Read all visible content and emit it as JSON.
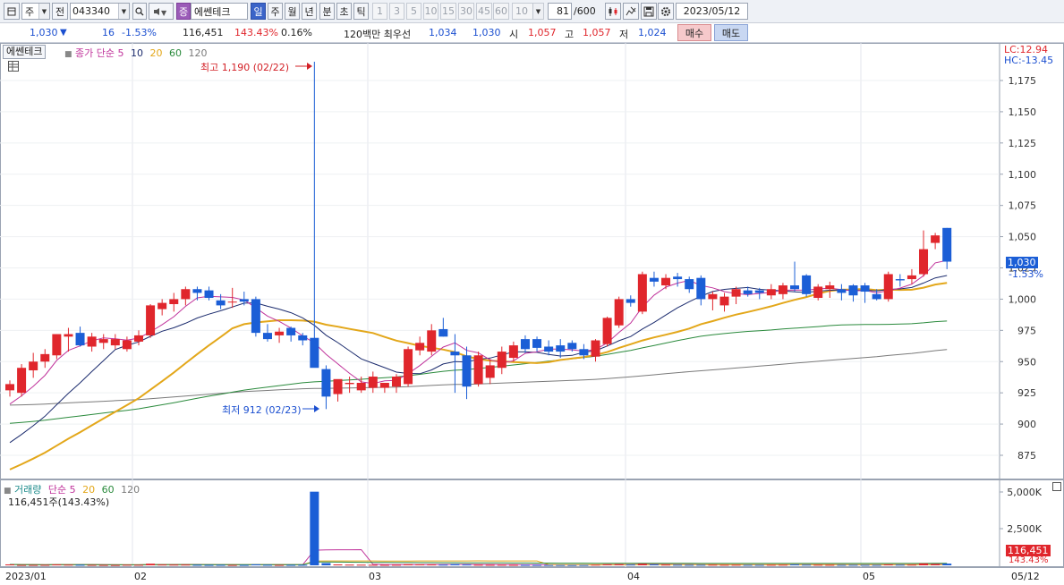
{
  "toolbar": {
    "period_prefix": "주",
    "prev_label": "전",
    "code": "043340",
    "name": "에쎈테크",
    "name_badge": "증",
    "periods": [
      "일",
      "주",
      "월",
      "년",
      "분",
      "초",
      "틱"
    ],
    "active_period": "일",
    "intervals": [
      "1",
      "3",
      "5",
      "10",
      "15",
      "30",
      "45",
      "60"
    ],
    "interval_select": "10",
    "count": "81",
    "count_max": "/600",
    "date": "2023/05/12"
  },
  "quote": {
    "price": "1,030",
    "change_arrow": "▼",
    "change": "16",
    "change_pct": "-1.53%",
    "volume": "116,451",
    "volume_ratio": "143.43%",
    "turnover": "0.16%",
    "best_bid_label": "120백만 최우선",
    "best_ask": "1,034",
    "best_bid": "1,030",
    "open_label": "시",
    "open": "1,057",
    "high_label": "고",
    "high": "1,057",
    "low_label": "저",
    "low": "1,024",
    "buy_label": "매수",
    "sell_label": "매도"
  },
  "price_panel": {
    "stock_tag": "에쎈테크",
    "ma_title": "종가 단순",
    "ma_periods": [
      "5",
      "10",
      "20",
      "60",
      "120"
    ],
    "lc": "LC:12.94",
    "hc": "HC:-13.45",
    "current_badge": "1,030",
    "current_pct": "-1.53%",
    "high_annotation": "최고 1,190 (02/22)",
    "low_annotation": "최저 912 (02/23)"
  },
  "volume_panel": {
    "title": "거래량",
    "ma_title": "단순",
    "ma_periods": [
      "5",
      "20",
      "60",
      "120"
    ],
    "info": "116,451주(143.43%)",
    "current_badge": "116,451",
    "current_pct": "143.43%"
  },
  "x_axis": {
    "labels": [
      "2023/01",
      "02",
      "03",
      "04",
      "05"
    ],
    "end_label": "05/12"
  },
  "colors": {
    "up": "#e0262c",
    "down": "#1b5ed6",
    "ma5": "#c0339b",
    "ma10": "#1c2c6e",
    "ma20": "#e3a71a",
    "ma60": "#2a8a3c",
    "ma120": "#7a7a7a"
  },
  "chart_data": {
    "type": "candlestick",
    "y_axis": {
      "min": 875,
      "max": 1175,
      "ticks": [
        875,
        900,
        925,
        950,
        975,
        1000,
        1025,
        1050,
        1075,
        1100,
        1125,
        1150,
        1175
      ]
    },
    "volume_axis": {
      "ticks": [
        "2,500K",
        "5,000K"
      ]
    },
    "candles": [
      {
        "o": 927,
        "h": 935,
        "l": 922,
        "c": 932
      },
      {
        "o": 925,
        "h": 948,
        "l": 922,
        "c": 945
      },
      {
        "o": 943,
        "h": 957,
        "l": 937,
        "c": 950
      },
      {
        "o": 950,
        "h": 960,
        "l": 945,
        "c": 956
      },
      {
        "o": 955,
        "h": 972,
        "l": 952,
        "c": 972
      },
      {
        "o": 970,
        "h": 977,
        "l": 958,
        "c": 972
      },
      {
        "o": 973,
        "h": 978,
        "l": 962,
        "c": 963
      },
      {
        "o": 962,
        "h": 973,
        "l": 958,
        "c": 970
      },
      {
        "o": 965,
        "h": 972,
        "l": 960,
        "c": 968
      },
      {
        "o": 963,
        "h": 972,
        "l": 960,
        "c": 968
      },
      {
        "o": 960,
        "h": 970,
        "l": 958,
        "c": 967
      },
      {
        "o": 966,
        "h": 975,
        "l": 963,
        "c": 971
      },
      {
        "o": 971,
        "h": 996,
        "l": 969,
        "c": 995
      },
      {
        "o": 992,
        "h": 1000,
        "l": 987,
        "c": 997
      },
      {
        "o": 996,
        "h": 1005,
        "l": 990,
        "c": 1000
      },
      {
        "o": 1000,
        "h": 1010,
        "l": 995,
        "c": 1008
      },
      {
        "o": 1008,
        "h": 1010,
        "l": 999,
        "c": 1005
      },
      {
        "o": 1007,
        "h": 1010,
        "l": 999,
        "c": 1001
      },
      {
        "o": 999,
        "h": 1004,
        "l": 992,
        "c": 995
      },
      {
        "o": 998,
        "h": 1009,
        "l": 993,
        "c": 998
      },
      {
        "o": 1000,
        "h": 1006,
        "l": 995,
        "c": 998
      },
      {
        "o": 1000,
        "h": 1002,
        "l": 970,
        "c": 973
      },
      {
        "o": 973,
        "h": 980,
        "l": 966,
        "c": 968
      },
      {
        "o": 971,
        "h": 977,
        "l": 965,
        "c": 974
      },
      {
        "o": 977,
        "h": 978,
        "l": 966,
        "c": 971
      },
      {
        "o": 971,
        "h": 973,
        "l": 963,
        "c": 967
      },
      {
        "o": 969,
        "h": 1190,
        "l": 950,
        "c": 945
      },
      {
        "o": 944,
        "h": 947,
        "l": 912,
        "c": 922
      },
      {
        "o": 924,
        "h": 935,
        "l": 918,
        "c": 936
      },
      {
        "o": 932,
        "h": 938,
        "l": 925,
        "c": 933
      },
      {
        "o": 927,
        "h": 938,
        "l": 925,
        "c": 933
      },
      {
        "o": 929,
        "h": 942,
        "l": 925,
        "c": 938
      },
      {
        "o": 929,
        "h": 933,
        "l": 925,
        "c": 933
      },
      {
        "o": 930,
        "h": 940,
        "l": 925,
        "c": 938
      },
      {
        "o": 932,
        "h": 962,
        "l": 930,
        "c": 960
      },
      {
        "o": 959,
        "h": 970,
        "l": 955,
        "c": 965
      },
      {
        "o": 958,
        "h": 980,
        "l": 955,
        "c": 975
      },
      {
        "o": 976,
        "h": 985,
        "l": 970,
        "c": 970
      },
      {
        "o": 958,
        "h": 972,
        "l": 925,
        "c": 955
      },
      {
        "o": 955,
        "h": 962,
        "l": 920,
        "c": 930
      },
      {
        "o": 932,
        "h": 958,
        "l": 930,
        "c": 955
      },
      {
        "o": 937,
        "h": 952,
        "l": 932,
        "c": 947
      },
      {
        "o": 945,
        "h": 962,
        "l": 940,
        "c": 958
      },
      {
        "o": 953,
        "h": 966,
        "l": 950,
        "c": 963
      },
      {
        "o": 968,
        "h": 971,
        "l": 957,
        "c": 960
      },
      {
        "o": 968,
        "h": 970,
        "l": 958,
        "c": 961
      },
      {
        "o": 962,
        "h": 967,
        "l": 955,
        "c": 958
      },
      {
        "o": 963,
        "h": 968,
        "l": 953,
        "c": 958
      },
      {
        "o": 965,
        "h": 967,
        "l": 958,
        "c": 960
      },
      {
        "o": 960,
        "h": 964,
        "l": 952,
        "c": 955
      },
      {
        "o": 954,
        "h": 968,
        "l": 950,
        "c": 967
      },
      {
        "o": 964,
        "h": 986,
        "l": 962,
        "c": 985
      },
      {
        "o": 979,
        "h": 1002,
        "l": 977,
        "c": 1000
      },
      {
        "o": 1000,
        "h": 1003,
        "l": 994,
        "c": 997
      },
      {
        "o": 990,
        "h": 1022,
        "l": 988,
        "c": 1020
      },
      {
        "o": 1017,
        "h": 1022,
        "l": 1010,
        "c": 1014
      },
      {
        "o": 1011,
        "h": 1020,
        "l": 1008,
        "c": 1017
      },
      {
        "o": 1018,
        "h": 1021,
        "l": 1010,
        "c": 1016
      },
      {
        "o": 1016,
        "h": 1018,
        "l": 1005,
        "c": 1008
      },
      {
        "o": 1017,
        "h": 1019,
        "l": 995,
        "c": 1000
      },
      {
        "o": 1000,
        "h": 1006,
        "l": 991,
        "c": 1004
      },
      {
        "o": 995,
        "h": 1005,
        "l": 990,
        "c": 1002
      },
      {
        "o": 1002,
        "h": 1010,
        "l": 996,
        "c": 1008
      },
      {
        "o": 1007,
        "h": 1010,
        "l": 1002,
        "c": 1004
      },
      {
        "o": 1007,
        "h": 1009,
        "l": 1000,
        "c": 1005
      },
      {
        "o": 1003,
        "h": 1012,
        "l": 1000,
        "c": 1008
      },
      {
        "o": 1004,
        "h": 1013,
        "l": 1000,
        "c": 1011
      },
      {
        "o": 1011,
        "h": 1030,
        "l": 1006,
        "c": 1008
      },
      {
        "o": 1019,
        "h": 1020,
        "l": 1002,
        "c": 1004
      },
      {
        "o": 1001,
        "h": 1012,
        "l": 999,
        "c": 1010
      },
      {
        "o": 1008,
        "h": 1014,
        "l": 1001,
        "c": 1011
      },
      {
        "o": 1008,
        "h": 1012,
        "l": 999,
        "c": 1005
      },
      {
        "o": 1011,
        "h": 1012,
        "l": 998,
        "c": 1003
      },
      {
        "o": 1011,
        "h": 1013,
        "l": 997,
        "c": 1006
      },
      {
        "o": 1004,
        "h": 1008,
        "l": 999,
        "c": 1000
      },
      {
        "o": 1000,
        "h": 1022,
        "l": 998,
        "c": 1020
      },
      {
        "o": 1016,
        "h": 1020,
        "l": 1010,
        "c": 1015
      },
      {
        "o": 1016,
        "h": 1024,
        "l": 1012,
        "c": 1019
      },
      {
        "o": 1020,
        "h": 1055,
        "l": 1018,
        "c": 1040
      },
      {
        "o": 1045,
        "h": 1053,
        "l": 1040,
        "c": 1051
      },
      {
        "o": 1057,
        "h": 1057,
        "l": 1024,
        "c": 1030
      }
    ],
    "volume": [
      62,
      28,
      30,
      34,
      58,
      45,
      38,
      32,
      28,
      25,
      40,
      38,
      110,
      52,
      48,
      50,
      36,
      30,
      34,
      28,
      30,
      66,
      38,
      30,
      32,
      34,
      5020,
      150,
      60,
      48,
      44,
      38,
      35,
      40,
      70,
      62,
      58,
      46,
      80,
      55,
      42,
      38,
      40,
      36,
      34,
      32,
      30,
      28,
      26,
      30,
      45,
      70,
      80,
      52,
      110,
      60,
      48,
      40,
      36,
      38,
      42,
      38,
      40,
      36,
      34,
      38,
      42,
      60,
      44,
      40,
      36,
      34,
      38,
      36,
      34,
      58,
      44,
      46,
      130,
      92,
      116
    ]
  }
}
